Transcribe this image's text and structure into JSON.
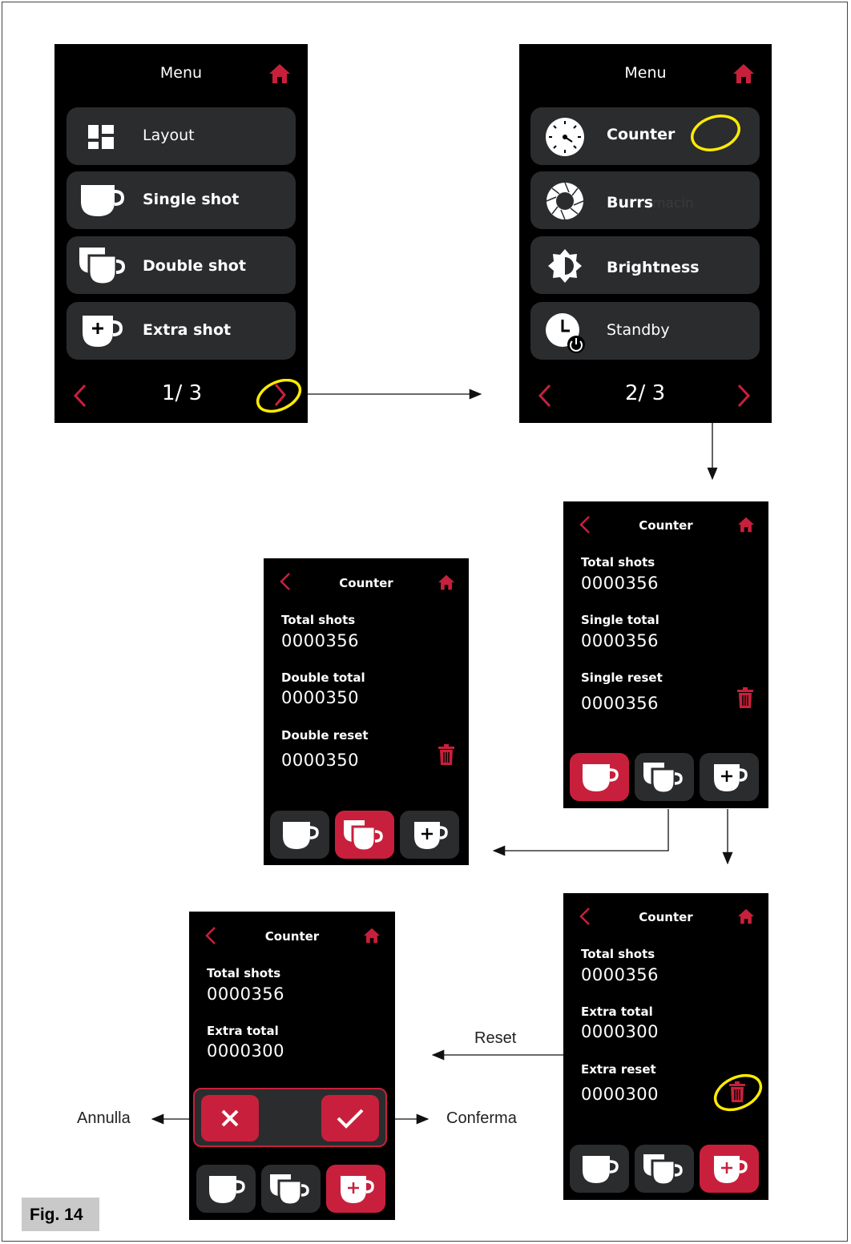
{
  "figure_label": "Fig. 14",
  "annotations": {
    "reset": "Reset",
    "cancel": "Annulla",
    "confirm": "Conferma"
  },
  "colors": {
    "accent": "#c8203c",
    "button_bg": "#2b2c2e",
    "highlight": "#ffeb00",
    "screen_bg": "#000000"
  },
  "screen_menu_1": {
    "title": "Menu",
    "items": [
      {
        "label": "Layout",
        "icon": "layout-icon"
      },
      {
        "label": "Single shot",
        "icon": "single-cup-icon"
      },
      {
        "label": "Double shot",
        "icon": "double-cup-icon"
      },
      {
        "label": "Extra shot",
        "icon": "extra-cup-icon"
      }
    ],
    "page": "1/ 3"
  },
  "screen_menu_2": {
    "title": "Menu",
    "items": [
      {
        "label": "Counter",
        "icon": "counter-icon"
      },
      {
        "label": "Burrs",
        "icon": "burrs-icon"
      },
      {
        "label": "Brightness",
        "icon": "brightness-icon"
      },
      {
        "label": "Standby",
        "icon": "standby-icon"
      }
    ],
    "ghost_text": "macin",
    "page": "2/ 3"
  },
  "screen_counter_single": {
    "title": "Counter",
    "rows": [
      {
        "label": "Total shots",
        "value": "0000356"
      },
      {
        "label": "Single total",
        "value": "0000356"
      },
      {
        "label": "Single reset",
        "value": "0000356"
      }
    ]
  },
  "screen_counter_double": {
    "title": "Counter",
    "rows": [
      {
        "label": "Total shots",
        "value": "0000356"
      },
      {
        "label": "Double total",
        "value": "0000350"
      },
      {
        "label": "Double reset",
        "value": "0000350"
      }
    ]
  },
  "screen_counter_extra": {
    "title": "Counter",
    "rows": [
      {
        "label": "Total shots",
        "value": "0000356"
      },
      {
        "label": "Extra total",
        "value": "0000300"
      },
      {
        "label": "Extra reset",
        "value": "0000300"
      }
    ]
  },
  "screen_counter_confirm": {
    "title": "Counter",
    "rows": [
      {
        "label": "Total shots",
        "value": "0000356"
      },
      {
        "label": "Extra total",
        "value": "0000300"
      }
    ]
  }
}
